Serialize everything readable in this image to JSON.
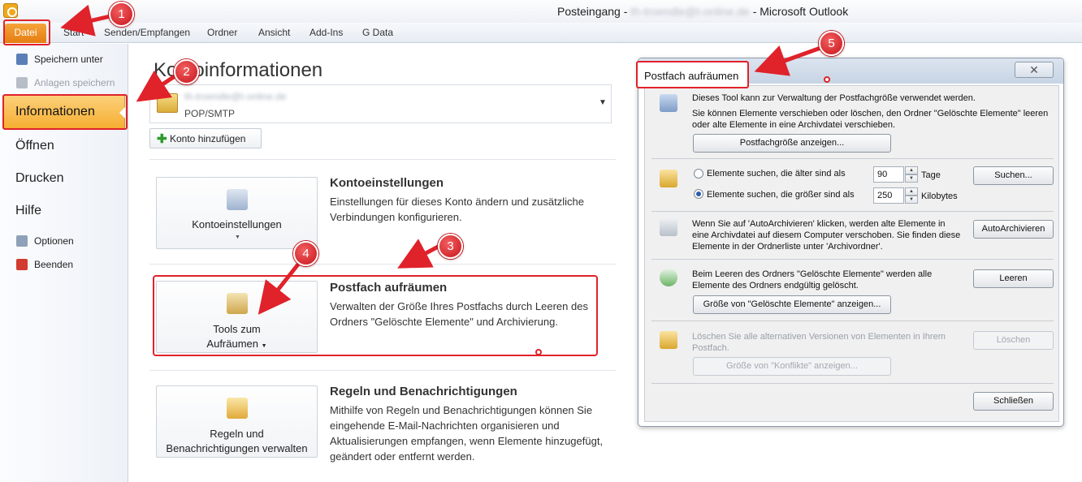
{
  "window": {
    "title_prefix": "Posteingang - ",
    "title_hidden": "th-troendle@t-online.de",
    "title_suffix": " - Microsoft Outlook"
  },
  "ribbon": {
    "tabs": [
      "Datei",
      "Start",
      "Senden/Empfangen",
      "Ordner",
      "Ansicht",
      "Add-Ins",
      "G Data"
    ]
  },
  "left_nav": {
    "save_as": "Speichern unter",
    "save_attachments": "Anlagen speichern",
    "info": "Informationen",
    "open": "Öffnen",
    "print": "Drucken",
    "help": "Hilfe",
    "options": "Optionen",
    "exit": "Beenden"
  },
  "main": {
    "title": "Kontoinformationen",
    "account": {
      "email": "th-troendle@t-online.de",
      "type": "POP/SMTP"
    },
    "add_account": "Konto hinzufügen",
    "sections": [
      {
        "button": "Kontoeinstellungen",
        "title": "Kontoeinstellungen",
        "desc": "Einstellungen für dieses Konto ändern und zusätzliche Verbindungen konfigurieren."
      },
      {
        "button_line1": "Tools zum",
        "button_line2": "Aufräumen",
        "title": "Postfach aufräumen",
        "desc": "Verwalten der Größe Ihres Postfachs durch Leeren des Ordners \"Gelöschte Elemente\" und Archivierung."
      },
      {
        "button_line1": "Regeln und",
        "button_line2": "Benachrichtigungen verwalten",
        "title": "Regeln und Benachrichtigungen",
        "desc": "Mithilfe von Regeln und Benachrichtigungen können Sie eingehende E-Mail-Nachrichten organisieren und Aktualisierungen empfangen, wenn Elemente hinzugefügt, geändert oder entfernt werden."
      }
    ]
  },
  "dialog": {
    "title": "Postfach aufräumen",
    "intro1": "Dieses Tool kann zur Verwaltung der Postfachgröße verwendet werden.",
    "intro2": "Sie können Elemente verschieben oder löschen, den Ordner \"Gelöschte Elemente\" leeren oder alte Elemente in eine Archivdatei verschieben.",
    "show_size_btn": "Postfachgröße anzeigen...",
    "older_label": "Elemente suchen, die älter sind als",
    "older_value": "90",
    "older_unit": "Tage",
    "larger_label": "Elemente suchen, die größer sind als",
    "larger_value": "250",
    "larger_unit": "Kilobytes",
    "search_btn": "Suchen...",
    "autoarchive_text": "Wenn Sie auf 'AutoArchivieren' klicken, werden alte Elemente in eine Archivdatei auf diesem Computer verschoben. Sie finden diese Elemente in der Ordnerliste unter 'Archivordner'.",
    "autoarchive_btn": "AutoArchivieren",
    "empty_text": "Beim Leeren des Ordners \"Gelöschte Elemente\" werden alle Elemente des Ordners endgültig gelöscht.",
    "empty_btn": "Leeren",
    "deleted_size_btn": "Größe von \"Gelöschte Elemente\" anzeigen...",
    "conflicts_text": "Löschen Sie alle alternativen Versionen von Elementen in Ihrem Postfach.",
    "delete_btn": "Löschen",
    "conflicts_size_btn": "Größe von \"Konflikte\" anzeigen...",
    "close_btn": "Schließen"
  },
  "callouts": [
    "1",
    "2",
    "3",
    "4",
    "5"
  ],
  "colors": {
    "accent_orange": "#f6ae32",
    "annotation_red": "#e0222a"
  }
}
